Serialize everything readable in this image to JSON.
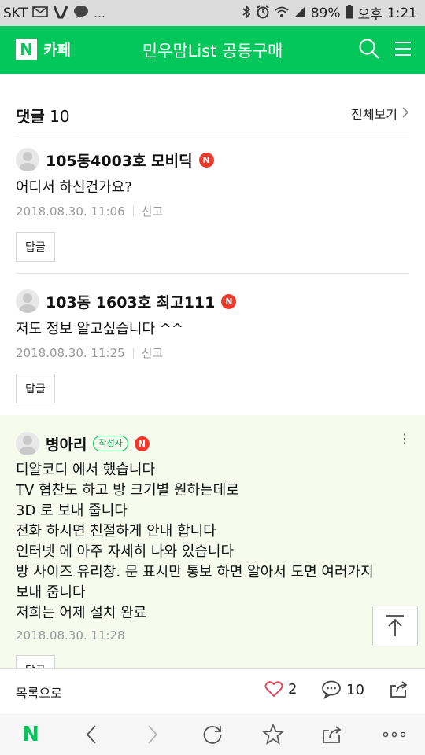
{
  "status_bar": {
    "carrier": "SKT",
    "battery": "89%",
    "ampm": "오후",
    "time": "1:21",
    "left_icons": [
      "mail-icon",
      "v-icon",
      "chat-bubble-icon",
      "more-dots"
    ],
    "right_icons": [
      "bluetooth-icon",
      "alarm-icon",
      "wifi-icon",
      "signal-icon",
      "battery-icon"
    ]
  },
  "header": {
    "logo_letter": "N",
    "cafe_label": "카페",
    "title": "민우맘List 공동구매",
    "icons": [
      "search-icon",
      "menu-icon"
    ],
    "brand_color": "#03c75a"
  },
  "comments_header": {
    "label": "댓글",
    "count": "10",
    "see_all": "전체보기"
  },
  "comments": [
    {
      "nickname": "105동4003호 모비딕",
      "badge": "N",
      "text": "어디서 하신건가요?",
      "date": "2018.08.30. 11:06",
      "report": "신고",
      "reply": "답글"
    },
    {
      "nickname": "103동 1603호 최고111",
      "badge": "N",
      "text": "저도 정보 알고싶습니다 ^^",
      "date": "2018.08.30. 11:25",
      "report": "신고",
      "reply": "답글"
    },
    {
      "nickname": "병아리",
      "writer_tag": "작성자",
      "badge": "N",
      "lines": [
        "디알코디 에서 했습니다",
        "TV 협찬도 하고 방 크기별 원하는데로",
        "3D 로 보내 줍니다",
        "전화 하시면 친절하게 안내 합니다",
        "인터넷 에 아주 자세히 나와 있습니다",
        "방 사이즈 유리창. 문 표시만 통보 하면 알아서 도면 여러가지",
        "보내 줍니다",
        "저희는 어제 설치 완료"
      ],
      "date": "2018.08.30. 11:28",
      "reply": "답글"
    }
  ],
  "action_bar": {
    "to_list": "목록으로",
    "likes": "2",
    "comments": "10"
  },
  "nav_bar": {
    "items": [
      "naver-home-icon",
      "back-icon",
      "forward-icon",
      "refresh-icon",
      "bookmark-star-icon",
      "share-icon",
      "more-icon"
    ],
    "home_letter": "N"
  }
}
